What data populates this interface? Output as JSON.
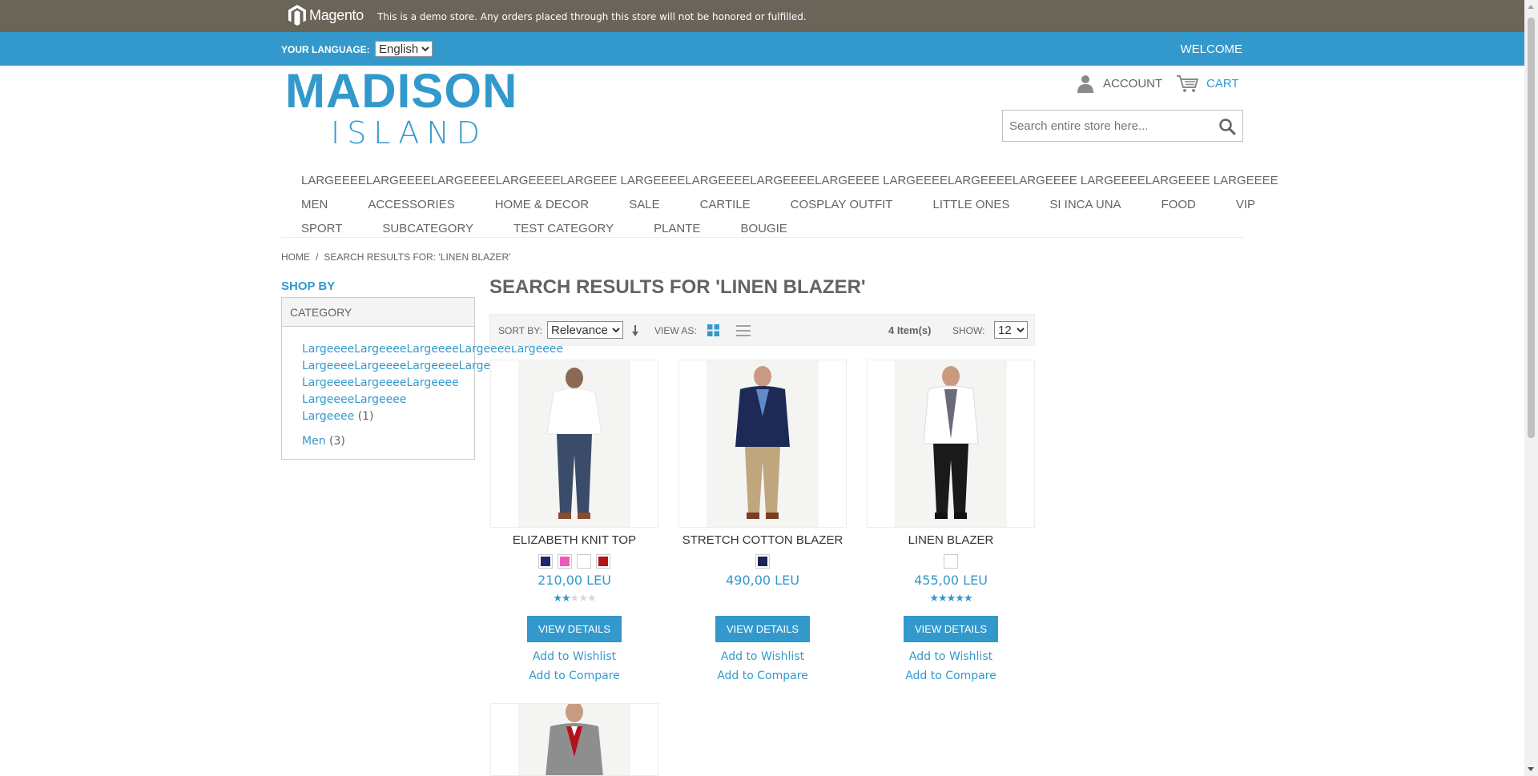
{
  "notice": {
    "logo_text": "Magento",
    "message": "This is a demo store. Any orders placed through this store will not be honored or fulfilled."
  },
  "header": {
    "language_label": "YOUR LANGUAGE:",
    "language_value": "English",
    "welcome": "WELCOME",
    "brand_line1": "MADISON",
    "brand_line2": "ISLAND",
    "account": "ACCOUNT",
    "cart": "CART",
    "search_placeholder": "Search entire store here..."
  },
  "nav": {
    "row1": [
      "LARGEEEELARGEEEELARGEEEELARGEEEELARGEEE LARGEEEELARGEEEELARGEEEELARGEEEE LARGEEEELARGEEEELARGEEEE LARGEEEELARGEEEE LARGEEEE"
    ],
    "row2": [
      "MEN",
      "ACCESSORIES",
      "HOME & DECOR",
      "SALE",
      "CARTILE",
      "COSPLAY OUTFIT",
      "LITTLE ONES",
      "SI INCA UNA",
      "FOOD",
      "VIP"
    ],
    "row3": [
      "SPORT",
      "SUBCATEGORY",
      "TEST CATEGORY",
      "PLANTE",
      "BOUGIE"
    ]
  },
  "breadcrumb": {
    "home": "HOME",
    "separator": "/",
    "current": "SEARCH RESULTS FOR: 'LINEN BLAZER'"
  },
  "sidebar": {
    "shop_by": "SHOP BY",
    "category_header": "CATEGORY",
    "categories": [
      {
        "label": "LargeeeeLargeeeeLargeeeeLargeeeeLargeeee",
        "count": ""
      },
      {
        "label": "LargeeeeLargeeeeLargeeeeLargeeee",
        "count": ""
      },
      {
        "label": "LargeeeeLargeeeeLargeeee",
        "count": ""
      },
      {
        "label": "LargeeeeLargeeee",
        "count": ""
      },
      {
        "label": "Largeeee",
        "count": "(1)"
      },
      {
        "label": "Men",
        "count": "(3)"
      }
    ]
  },
  "main": {
    "title": "SEARCH RESULTS FOR 'LINEN BLAZER'",
    "toolbar": {
      "sort_label": "SORT BY:",
      "sort_value": "Relevance",
      "view_label": "VIEW AS:",
      "items_count": "4 Item(s)",
      "show_label": "SHOW:",
      "show_value": "12"
    },
    "products": [
      {
        "name": "ELIZABETH KNIT TOP",
        "swatches": [
          "#1c2a6b",
          "#ee5ab5",
          "#ffffff",
          "#b5121b"
        ],
        "price": "210,00 LEU",
        "rating_stars": 2,
        "button": "VIEW DETAILS",
        "wishlist": "Add to Wishlist",
        "compare": "Add to Compare"
      },
      {
        "name": "STRETCH COTTON BLAZER",
        "swatches": [
          "#1c2450"
        ],
        "price": "490,00 LEU",
        "rating_stars": 0,
        "button": "VIEW DETAILS",
        "wishlist": "Add to Wishlist",
        "compare": "Add to Compare"
      },
      {
        "name": "LINEN BLAZER",
        "swatches": [
          "#ffffff"
        ],
        "price": "455,00 LEU",
        "rating_stars": 5,
        "button": "VIEW DETAILS",
        "wishlist": "Add to Wishlist",
        "compare": "Add to Compare"
      }
    ]
  },
  "colors": {
    "accent": "#3399cc",
    "notice_bg": "#6b6459",
    "text": "#636363"
  },
  "icons": {
    "magento": "magento-logo-icon",
    "account": "user-icon",
    "cart": "cart-icon",
    "search": "search-icon",
    "sort_direction": "arrow-down-icon",
    "grid": "grid-view-icon",
    "list": "list-view-icon"
  }
}
